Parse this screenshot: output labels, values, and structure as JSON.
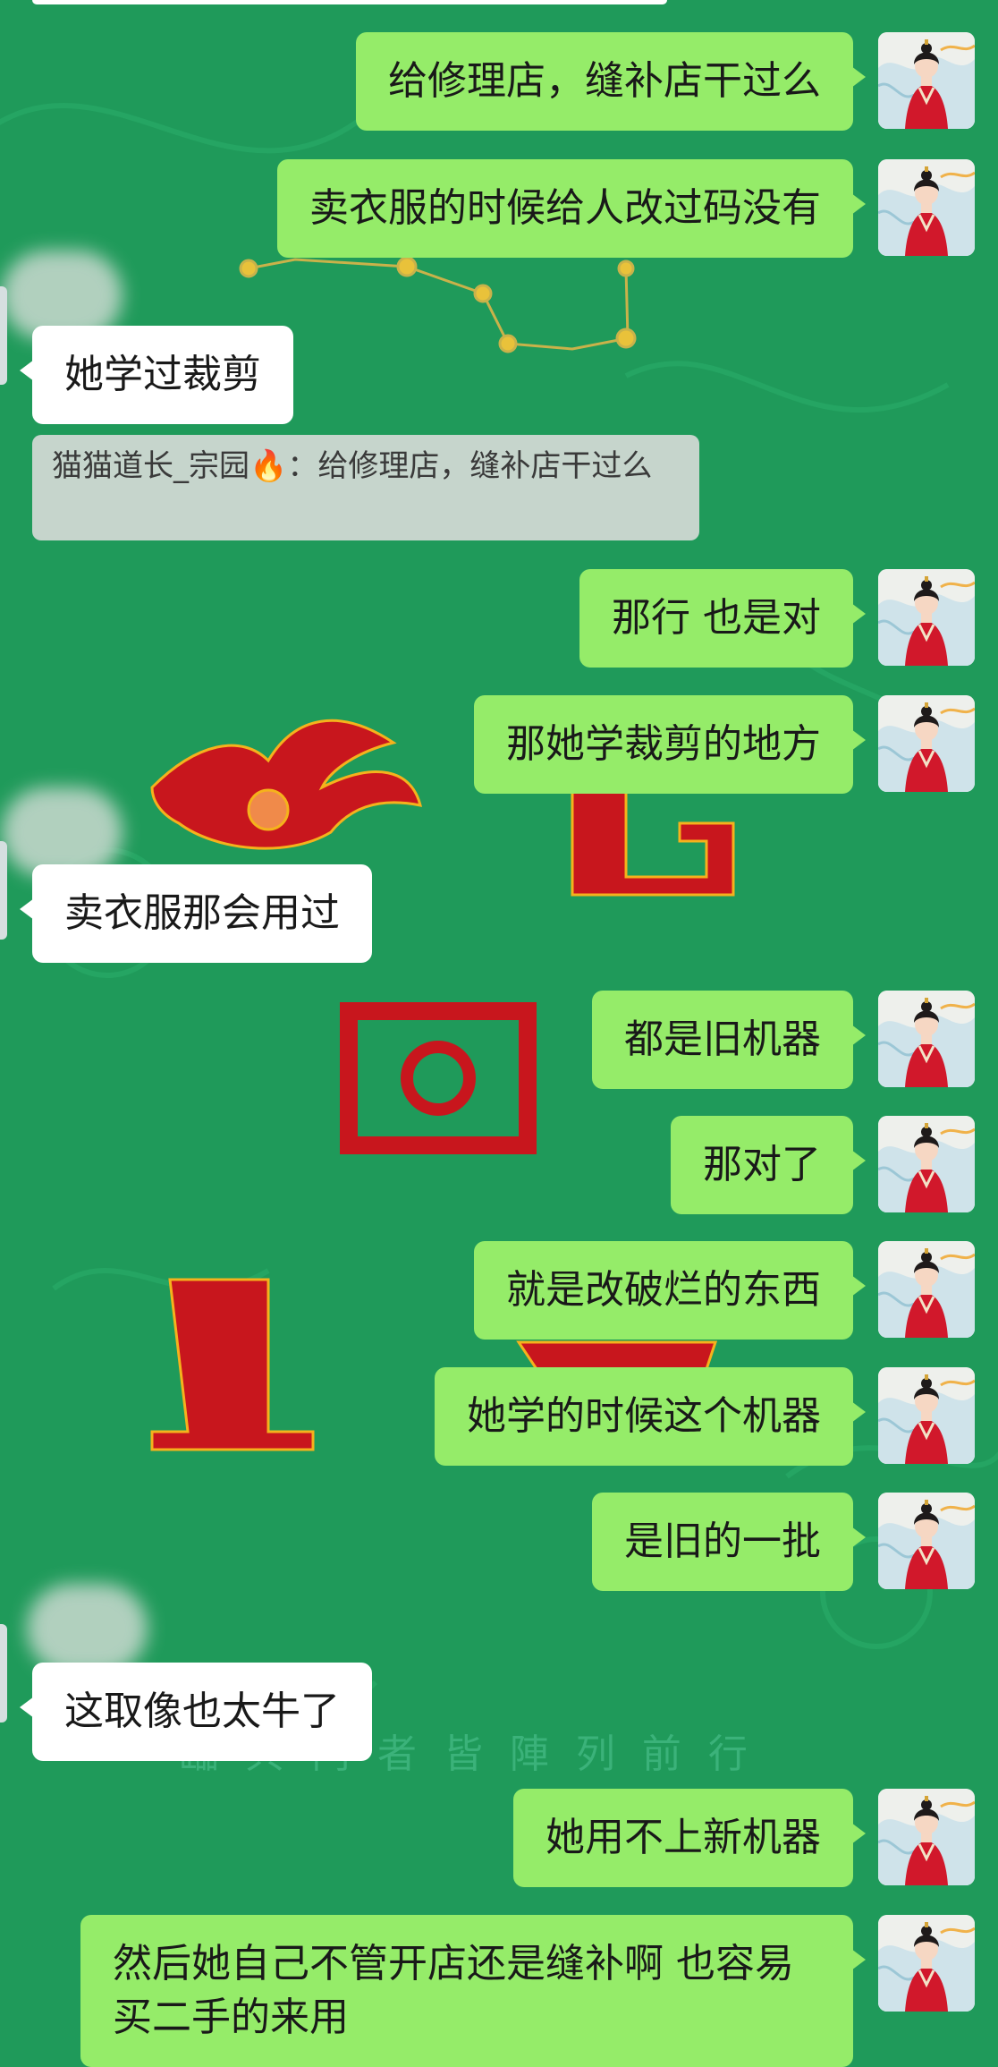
{
  "quote": {
    "sender": "猫猫道长_宗园",
    "fire_emoji": "🔥",
    "text": "：给修理店，缝补店干过么"
  },
  "messages": [
    {
      "side": "out",
      "text": "给修理店，缝补店干过么"
    },
    {
      "side": "out",
      "text": "卖衣服的时候给人改过码没有"
    },
    {
      "side": "in",
      "text": "她学过裁剪"
    },
    {
      "side": "out",
      "text": "那行 也是对"
    },
    {
      "side": "out",
      "text": "那她学裁剪的地方"
    },
    {
      "side": "in",
      "text": "卖衣服那会用过"
    },
    {
      "side": "out",
      "text": "都是旧机器"
    },
    {
      "side": "out",
      "text": "那对了"
    },
    {
      "side": "out",
      "text": "就是改破烂的东西"
    },
    {
      "side": "out",
      "text": "她学的时候这个机器"
    },
    {
      "side": "out",
      "text": "是旧的一批"
    },
    {
      "side": "in",
      "text": "这取像也太牛了"
    },
    {
      "side": "out",
      "text": "她用不上新机器"
    },
    {
      "side": "out",
      "text": "然后她自己不管开店还是缝补啊 也容易\n买二手的来用"
    }
  ],
  "background": {
    "tagline": "臨 兵 鬥 者 皆 陣 列 前 行",
    "color": "#1f9a5a"
  },
  "icons": {
    "my_avatar": "hanfu-girl-avatar",
    "other_avatar": "blurred-avatar"
  },
  "colors": {
    "outgoing_bubble": "#95ec69",
    "incoming_bubble": "#ffffff",
    "quote_bg": "#c6d5cc"
  }
}
